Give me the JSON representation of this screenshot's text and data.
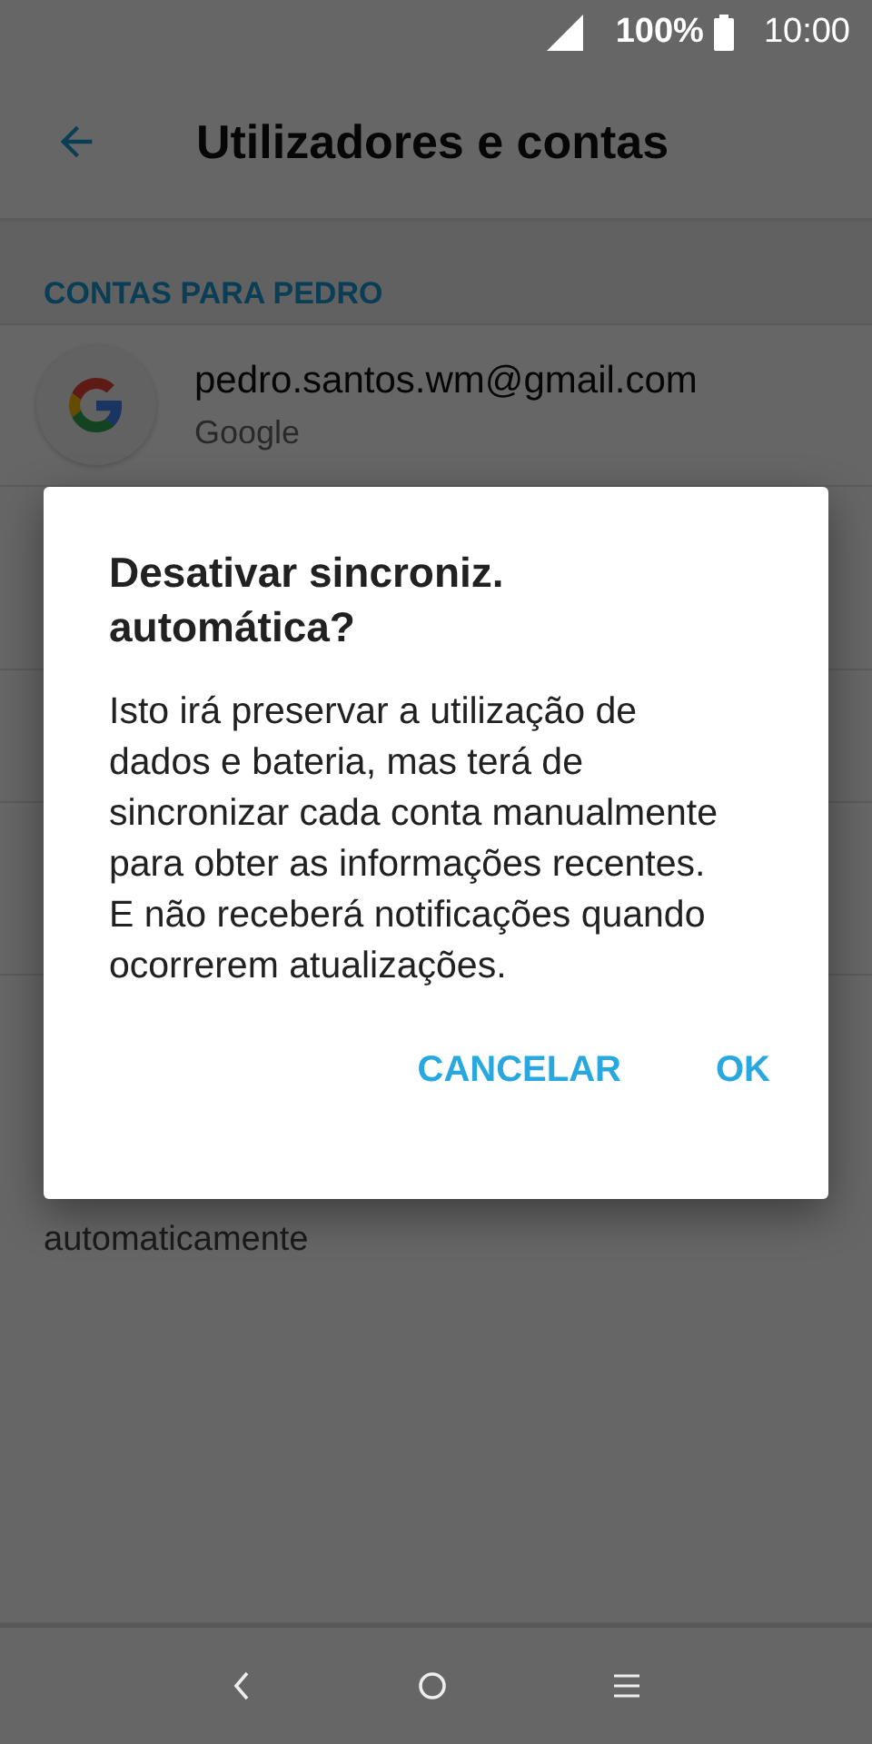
{
  "status_bar": {
    "battery": "100%",
    "time": "10:00"
  },
  "toolbar": {
    "title": "Utilizadores e contas"
  },
  "section": {
    "header": "CONTAS PARA PEDRO"
  },
  "accounts": [
    {
      "email": "pedro.santos.wm@gmail.com",
      "type": "Google"
    }
  ],
  "partial_text": "automaticamente",
  "dialog": {
    "title": "Desativar sincroniz. automática?",
    "message": "Isto irá preservar a utilização de dados e bateria, mas terá de sincronizar cada conta manualmente para obter as informações recentes. E não receberá notificações quando ocorrerem atualizações.",
    "buttons": [
      "CANCELAR",
      "OK"
    ]
  }
}
